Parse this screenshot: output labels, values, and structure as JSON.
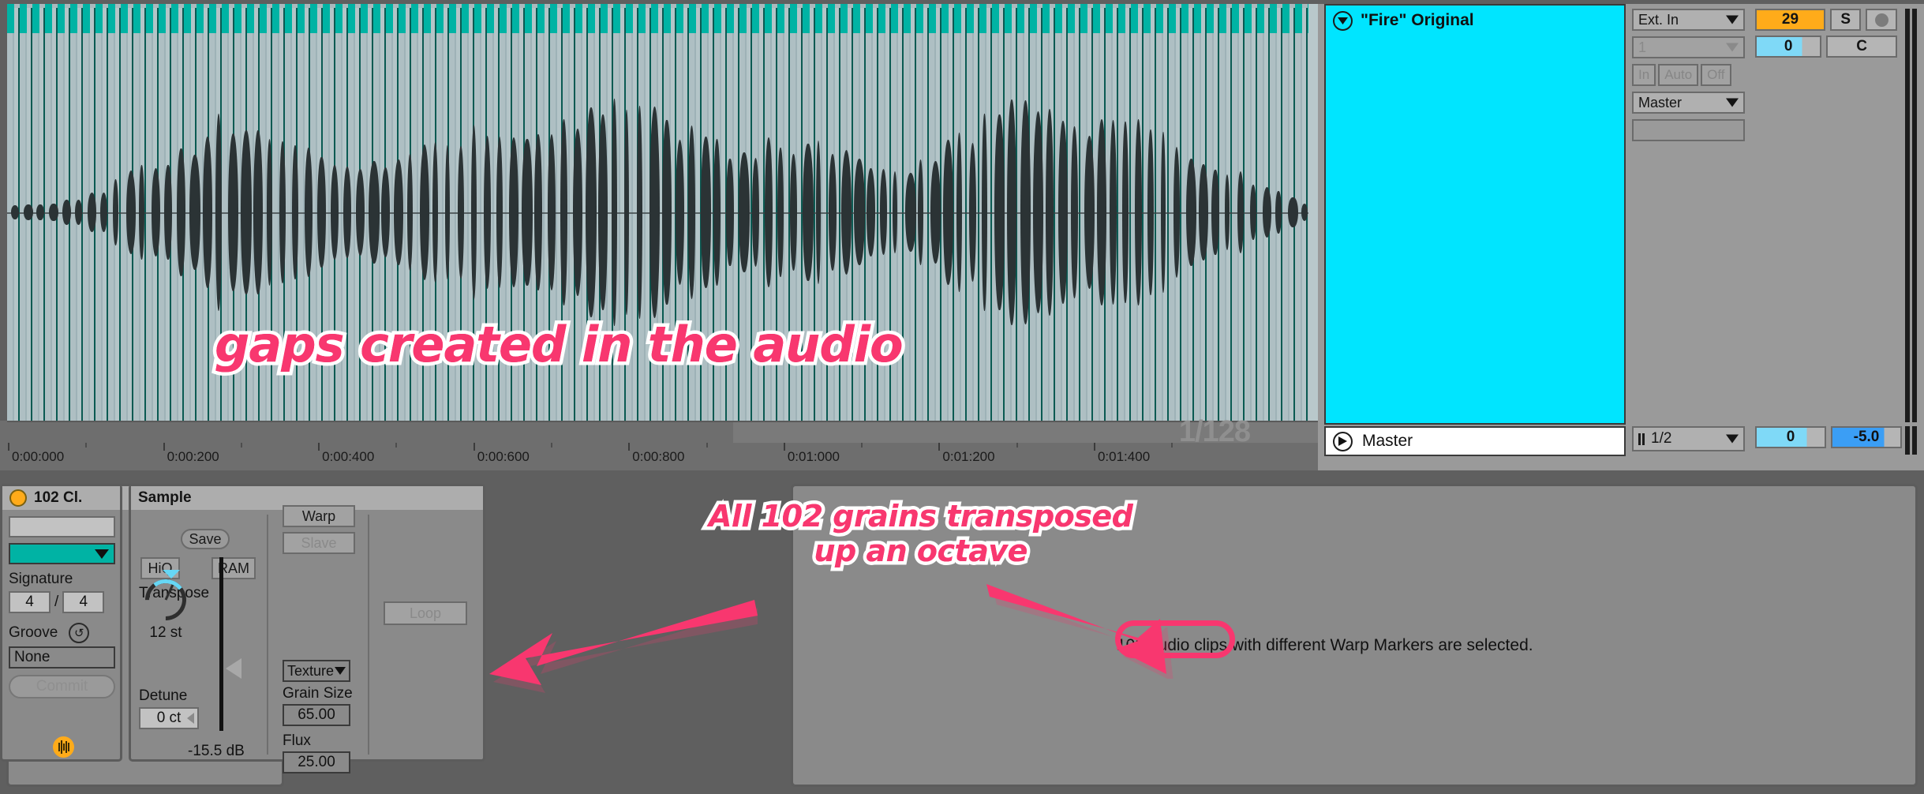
{
  "arrangement": {
    "zoom_level": "1/128",
    "ruler_labels": [
      "0:00:000",
      "0:00:200",
      "0:00:400",
      "0:00:600",
      "0:00:800",
      "0:01:000",
      "0:01:200",
      "0:01:400"
    ]
  },
  "track": {
    "title": "\"Fire\" Original",
    "collapse_icon": "chevron-down-icon",
    "color": "#00e5ff",
    "io": {
      "input_type": "Ext. In",
      "input_channel": "1",
      "monitor": [
        "In",
        "Auto",
        "Off"
      ],
      "output": "Master",
      "output_channel": ""
    },
    "mixer": {
      "send_a": "29",
      "solo": "S",
      "arm": "record-icon",
      "pan": "0",
      "pan_mode": "C"
    }
  },
  "master": {
    "title": "Master",
    "play_icon": "play-icon",
    "crossfade": "1/2",
    "pan": "0",
    "volume": "-5.0"
  },
  "browser": {
    "header": ""
  },
  "clip_box": {
    "header_label": "102 Cl.",
    "activator_icon": "clip-activator-icon",
    "name_value": "",
    "color_value": "",
    "signature_label": "Signature",
    "signature_num": "4",
    "signature_den": "4",
    "groove_label": "Groove",
    "groove_refresh_icon": "refresh-icon",
    "groove_value": "None",
    "commit_label": "Commit",
    "footer_icon": "waveform-icon"
  },
  "sample_box": {
    "header_label": "Sample",
    "save_label": "Save",
    "hiq_label": "HiQ",
    "ram_label": "RAM",
    "transpose_label": "Transpose",
    "transpose_value": "12 st",
    "detune_label": "Detune",
    "detune_value": "0 ct",
    "volume_db": "-15.5 dB",
    "warp_label": "Warp",
    "slave_label": "Slave",
    "warp_mode": "Texture",
    "grain_size_label": "Grain Size",
    "grain_size_value": "65.00",
    "flux_label": "Flux",
    "flux_value": "25.00",
    "loop_label": "Loop"
  },
  "right_panel": {
    "status_message": "102 audio clips with different Warp Markers are selected."
  },
  "annotations": {
    "gaps": "gaps created in the audio",
    "grains_line1": "All 102 grains transposed",
    "grains_line2": "up an octave",
    "highlight_color": "#f8376f"
  }
}
